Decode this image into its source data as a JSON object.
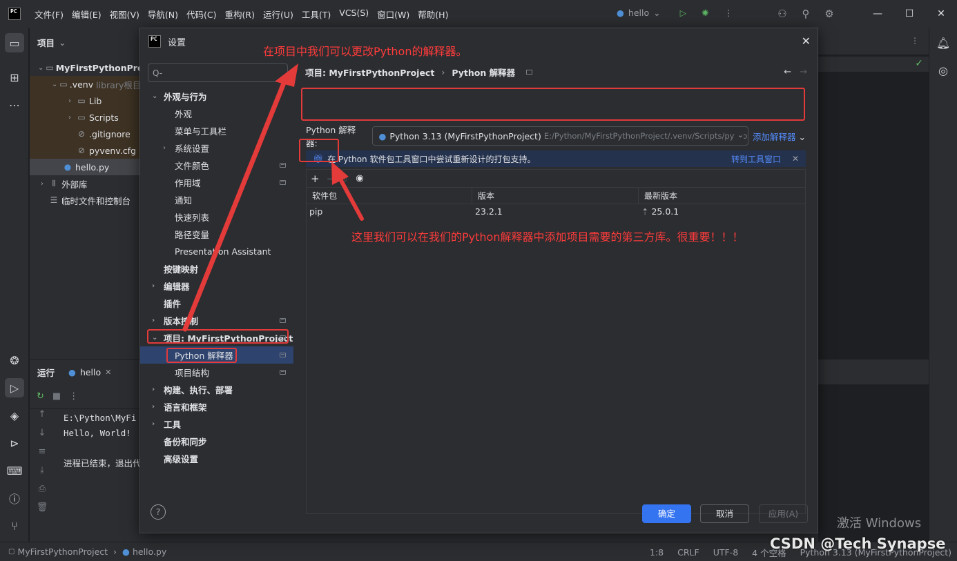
{
  "app": {
    "menu": [
      "文件(F)",
      "编辑(E)",
      "视图(V)",
      "导航(N)",
      "代码(C)",
      "重构(R)",
      "运行(U)",
      "工具(T)",
      "VCS(S)",
      "窗口(W)",
      "帮助(H)"
    ],
    "run_config": "hello"
  },
  "project_panel": {
    "title": "项目",
    "tree": [
      {
        "label": "MyFirstPythonProject",
        "kind": "folder",
        "indent": 0,
        "expanded": true
      },
      {
        "label": ".venv",
        "note": "library根目",
        "kind": "folder",
        "indent": 1,
        "expanded": true
      },
      {
        "label": "Lib",
        "kind": "folder",
        "indent": 2
      },
      {
        "label": "Scripts",
        "kind": "folder",
        "indent": 2
      },
      {
        "label": ".gitignore",
        "kind": "file",
        "indent": 2
      },
      {
        "label": "pyvenv.cfg",
        "kind": "file",
        "indent": 2
      },
      {
        "label": "hello.py",
        "kind": "py",
        "indent": 1
      },
      {
        "label": "外部库",
        "kind": "lib",
        "indent": 0
      },
      {
        "label": "临时文件和控制台",
        "kind": "scratch",
        "indent": 0
      }
    ]
  },
  "run_panel": {
    "title": "运行",
    "tab": "hello",
    "console": [
      "E:\\Python\\MyFi",
      "Hello, World!",
      "",
      "进程已结束，退出代"
    ]
  },
  "statusbar": {
    "breadcrumb": [
      "MyFirstPythonProject",
      "hello.py"
    ],
    "position": "1:8",
    "line_sep": "CRLF",
    "encoding": "UTF-8",
    "indent": "4 个空格",
    "interpreter": "Python 3.13 (MyFirstPythonProject)"
  },
  "dialog": {
    "title": "设置",
    "search_placeholder": "Q-",
    "nav": [
      {
        "label": "外观与行为",
        "bold": true,
        "chevron": "down",
        "level": 0
      },
      {
        "label": "外观",
        "level": 1
      },
      {
        "label": "菜单与工具栏",
        "level": 1
      },
      {
        "label": "系统设置",
        "level": 1,
        "chevron": "right"
      },
      {
        "label": "文件颜色",
        "level": 1,
        "proj": true
      },
      {
        "label": "作用域",
        "level": 1,
        "proj": true
      },
      {
        "label": "通知",
        "level": 1
      },
      {
        "label": "快速列表",
        "level": 1
      },
      {
        "label": "路径变量",
        "level": 1
      },
      {
        "label": "Presentation Assistant",
        "level": 1
      },
      {
        "label": "按键映射",
        "bold": true,
        "level": 0
      },
      {
        "label": "编辑器",
        "bold": true,
        "chevron": "right",
        "level": 0
      },
      {
        "label": "插件",
        "bold": true,
        "level": 0
      },
      {
        "label": "版本控制",
        "bold": true,
        "chevron": "right",
        "level": 0,
        "proj": true
      },
      {
        "label": "项目: MyFirstPythonProject",
        "bold": true,
        "chevron": "down",
        "level": 0,
        "proj": true
      },
      {
        "label": "Python 解释器",
        "level": 1,
        "proj": true,
        "selected": true
      },
      {
        "label": "项目结构",
        "level": 1,
        "proj": true
      },
      {
        "label": "构建、执行、部署",
        "bold": true,
        "chevron": "right",
        "level": 0
      },
      {
        "label": "语言和框架",
        "bold": true,
        "chevron": "right",
        "level": 0
      },
      {
        "label": "工具",
        "bold": true,
        "chevron": "right",
        "level": 0
      },
      {
        "label": "备份和同步",
        "bold": true,
        "level": 0
      },
      {
        "label": "高级设置",
        "bold": true,
        "level": 0
      }
    ],
    "breadcrumb": [
      "项目: MyFirstPythonProject",
      "Python 解释器"
    ],
    "interpreter_label": "Python 解释器:",
    "interpreter_value": "Python 3.13 (MyFirstPythonProject)",
    "interpreter_path": "E:/Python/MyFirstPythonProject/.venv/Scripts/python.",
    "add_interpreter": "添加解释器",
    "banner_text": "在 Python 软件包工具窗口中尝试重新设计的打包支持。",
    "banner_link": "转到工具窗口",
    "columns": [
      "软件包",
      "版本",
      "最新版本"
    ],
    "packages": [
      {
        "name": "pip",
        "version": "23.2.1",
        "latest": "25.0.1"
      }
    ],
    "ok": "确定",
    "cancel": "取消",
    "apply": "应用(A)"
  },
  "annotations": {
    "top": "在项目中我们可以更改Python的解释器。",
    "middle": "这里我们可以在我们的Python解释器中添加项目需要的第三方库。很重要！！！",
    "color": "#e33a3a"
  },
  "overlay": {
    "activate": "激活 Windows",
    "csdn": "CSDN @Tech Synapse"
  }
}
